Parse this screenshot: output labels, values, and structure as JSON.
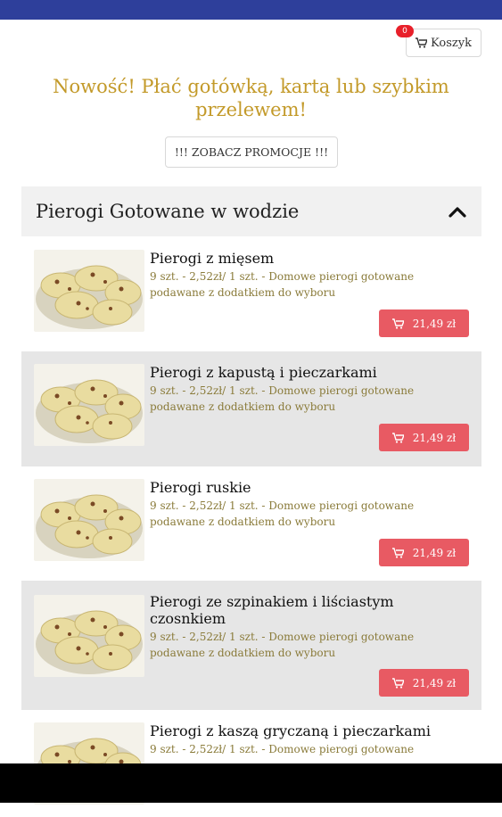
{
  "header": {
    "cart_label": "Koszyk",
    "cart_count": "0"
  },
  "promo": {
    "text": "Nowość! Płać gotówką, kartą lub szybkim przelewem!",
    "button_label": "!!! ZOBACZ PROMOCJE !!!"
  },
  "category": {
    "title": "Pierogi Gotowane w wodzie"
  },
  "items": [
    {
      "name": "Pierogi z mięsem",
      "desc": "9 szt. - 2,52zł/ 1 szt. - Domowe pierogi gotowane podawane z dodatkiem do wyboru",
      "price": "21,49 zł"
    },
    {
      "name": "Pierogi z kapustą i pieczarkami",
      "desc": "9 szt. - 2,52zł/ 1 szt. - Domowe pierogi gotowane podawane z dodatkiem do wyboru",
      "price": "21,49 zł"
    },
    {
      "name": "Pierogi ruskie",
      "desc": "9 szt. - 2,52zł/ 1 szt. - Domowe pierogi gotowane podawane z dodatkiem do wyboru",
      "price": "21,49 zł"
    },
    {
      "name": "Pierogi ze szpinakiem i liściastym czosnkiem",
      "desc": "9 szt. - 2,52zł/ 1 szt. - Domowe pierogi gotowane podawane z dodatkiem do wyboru",
      "price": "21,49 zł"
    },
    {
      "name": "Pierogi z kaszą gryczaną i pieczarkami",
      "desc": "9 szt. - 2,52zł/ 1 szt. - Domowe pierogi gotowane",
      "price": ""
    }
  ],
  "icons": {
    "cart": "cart-icon",
    "collapse": "chevron-up-icon",
    "product": "pierogi-image"
  },
  "colors": {
    "statusbar": "#2e3f9b",
    "accent_text": "#c39a2a",
    "price_button": "#e85a63",
    "badge": "#e8202a",
    "category_bg": "#f1f1f1",
    "alt_row_bg": "#e6e6e6"
  }
}
